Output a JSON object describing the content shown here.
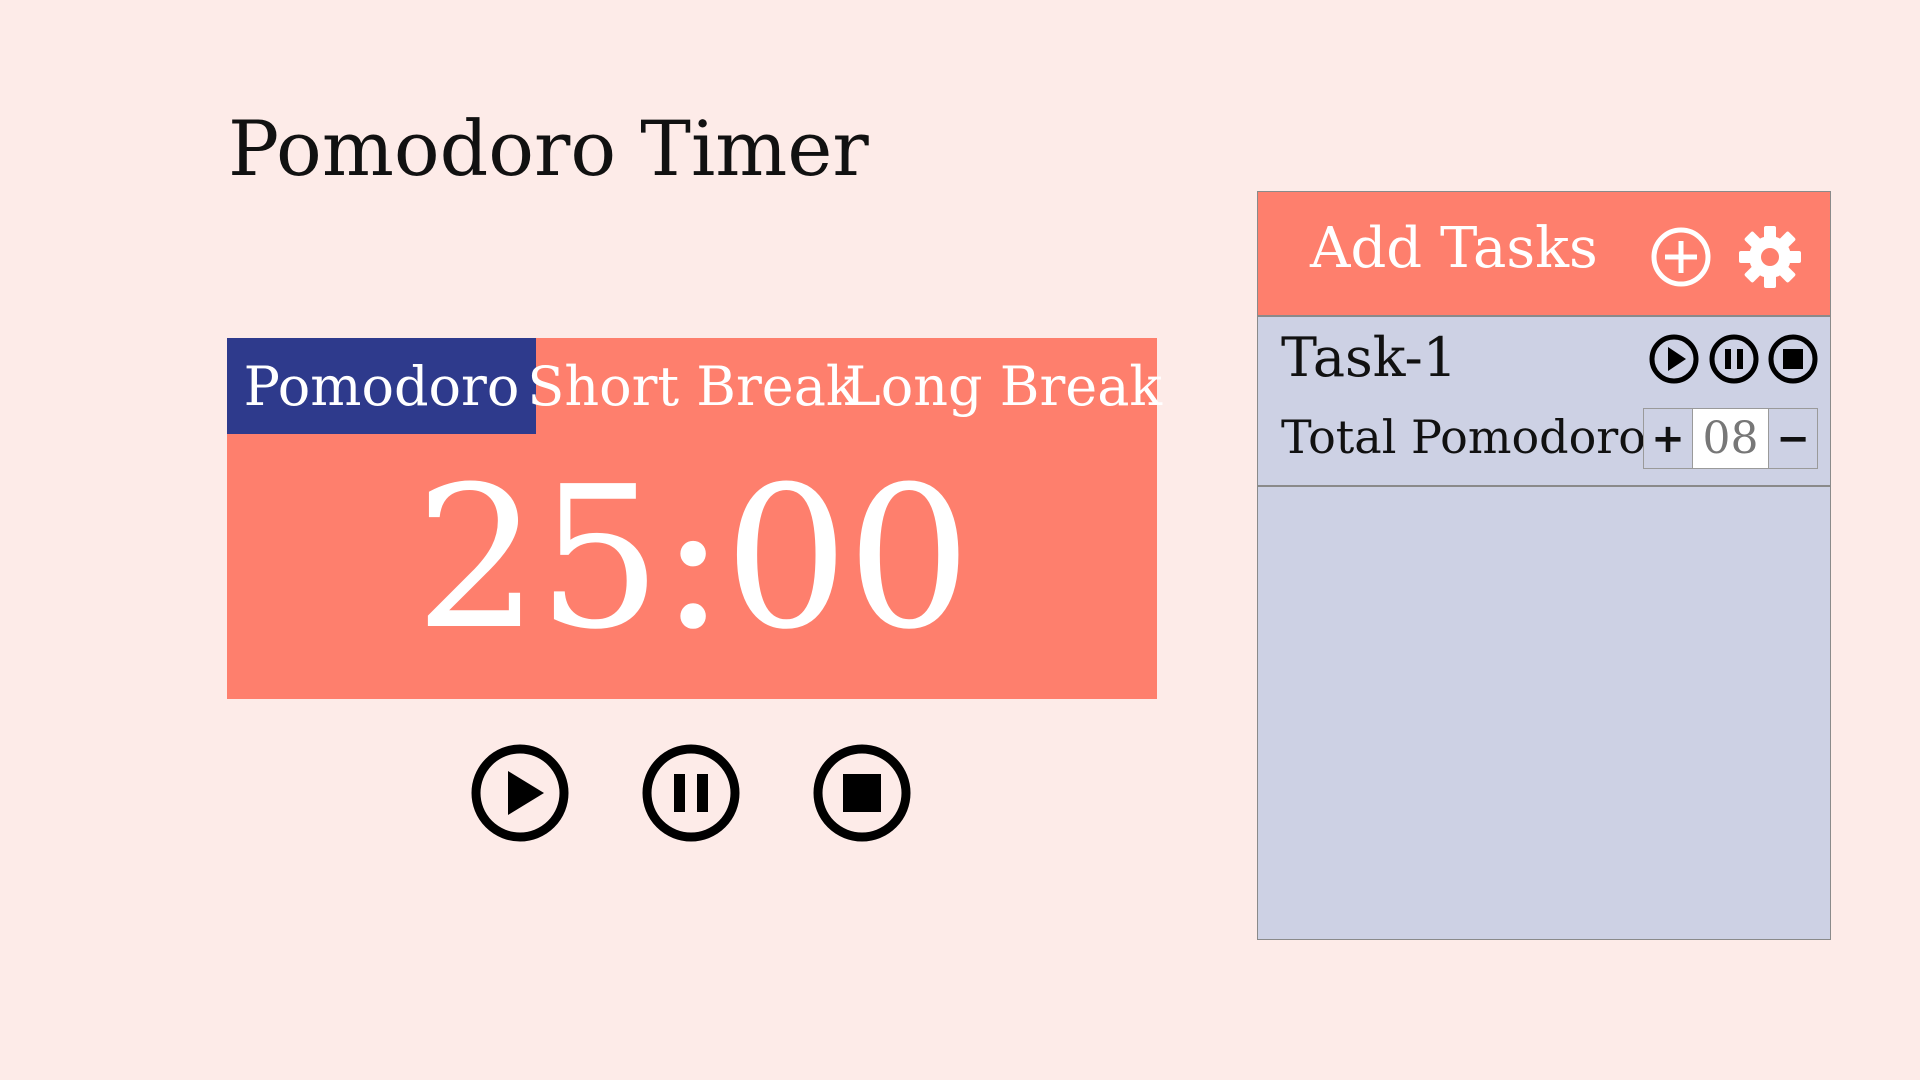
{
  "app": {
    "title": "Pomodoro Timer"
  },
  "timer": {
    "tabs": [
      {
        "label": "Pomodoro",
        "active": true
      },
      {
        "label": "Short Break",
        "active": false
      },
      {
        "label": "Long Break",
        "active": false
      }
    ],
    "display": "25:00",
    "controls": {
      "play_icon": "play-circle-icon",
      "pause_icon": "pause-circle-icon",
      "stop_icon": "stop-circle-icon"
    }
  },
  "tasks": {
    "header_title": "Add Tasks",
    "add_icon": "plus-circle-icon",
    "settings_icon": "gear-icon",
    "items": [
      {
        "name": "Task-1",
        "total_label": "Total Pomodoro:",
        "count": "08",
        "increment_label": "+",
        "decrement_label": "−"
      }
    ]
  },
  "colors": {
    "background": "#fdebe8",
    "accent": "#fe7f6d",
    "active_tab": "#2e3a8c",
    "panel": "#cdd1e4"
  }
}
